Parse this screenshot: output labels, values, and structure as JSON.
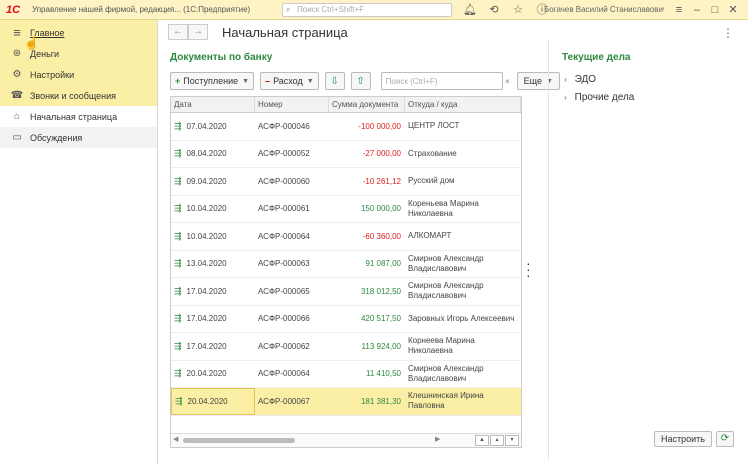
{
  "titlebar": {
    "logo": "1С",
    "title": "Управление нашей фирмой, редакция... (1С:Предприятие)",
    "search_placeholder": "Поиск Ctrl+Shift+F",
    "user": "Богачев Василий Станиславович",
    "icons": [
      "bell-icon",
      "history-icon",
      "star-icon",
      "info-icon"
    ],
    "window_icons": [
      "more-icon",
      "minimize-icon",
      "maximize-icon",
      "close-icon"
    ]
  },
  "sidebar": {
    "items": [
      {
        "label": "Главное",
        "icon": "menu-icon"
      },
      {
        "label": "Деньги",
        "icon": "money-icon"
      },
      {
        "label": "Настройки",
        "icon": "gear-icon"
      },
      {
        "label": "Звонки и сообщения",
        "icon": "phone-icon"
      },
      {
        "label": "Начальная страница",
        "icon": "home-icon"
      },
      {
        "label": "Обсуждения",
        "icon": "chat-icon"
      }
    ]
  },
  "header": {
    "back": "←",
    "forward": "→",
    "title": "Начальная страница"
  },
  "documents": {
    "title": "Документы по банку",
    "receipt_label": "Поступление",
    "expense_label": "Расход",
    "search_placeholder": "Поиск (Ctrl+F)",
    "more_label": "Еще",
    "columns": [
      "Дата",
      "Номер",
      "Сумма документа",
      "Откуда / куда"
    ],
    "rows": [
      {
        "date": "07.04.2020",
        "number": "АСФР-000046",
        "amount": "-100 000,00",
        "sign": "neg",
        "party": "ЦЕНТР ЛОСТ"
      },
      {
        "date": "08.04.2020",
        "number": "АСФР-000052",
        "amount": "-27 000,00",
        "sign": "neg",
        "party": "Страхование"
      },
      {
        "date": "09.04.2020",
        "number": "АСФР-000060",
        "amount": "-10 261,12",
        "sign": "neg",
        "party": "Русский дом"
      },
      {
        "date": "10.04.2020",
        "number": "АСФР-000061",
        "amount": "150 000,00",
        "sign": "pos",
        "party": "Кореньева Марина Николаевна"
      },
      {
        "date": "10.04.2020",
        "number": "АСФР-000064",
        "amount": "-60 360,00",
        "sign": "neg",
        "party": "АЛКОМАРТ"
      },
      {
        "date": "13.04.2020",
        "number": "АСФР-000063",
        "amount": "91 087,00",
        "sign": "pos",
        "party": "Смирнов Александр Владиславович"
      },
      {
        "date": "17.04.2020",
        "number": "АСФР-000065",
        "amount": "318 012,50",
        "sign": "pos",
        "party": "Смирнов Александр Владиславович"
      },
      {
        "date": "17.04.2020",
        "number": "АСФР-000066",
        "amount": "420 517,50",
        "sign": "pos",
        "party": "Заровных Игорь Алексеевич"
      },
      {
        "date": "17.04.2020",
        "number": "АСФР-000062",
        "amount": "113 924,00",
        "sign": "pos",
        "party": "Корнеева Марина Николаевна"
      },
      {
        "date": "20.04.2020",
        "number": "АСФР-000064",
        "amount": "11 410,50",
        "sign": "pos",
        "party": "Смирнов Александр Владиславович"
      },
      {
        "date": "20.04.2020",
        "number": "АСФР-000067",
        "amount": "181 381,30",
        "sign": "pos",
        "party": "Клешнинская Ирина Павловна"
      }
    ]
  },
  "tasks": {
    "title": "Текущие дела",
    "items": [
      "ЭДО",
      "Прочие дела"
    ],
    "setup_label": "Настроить"
  }
}
